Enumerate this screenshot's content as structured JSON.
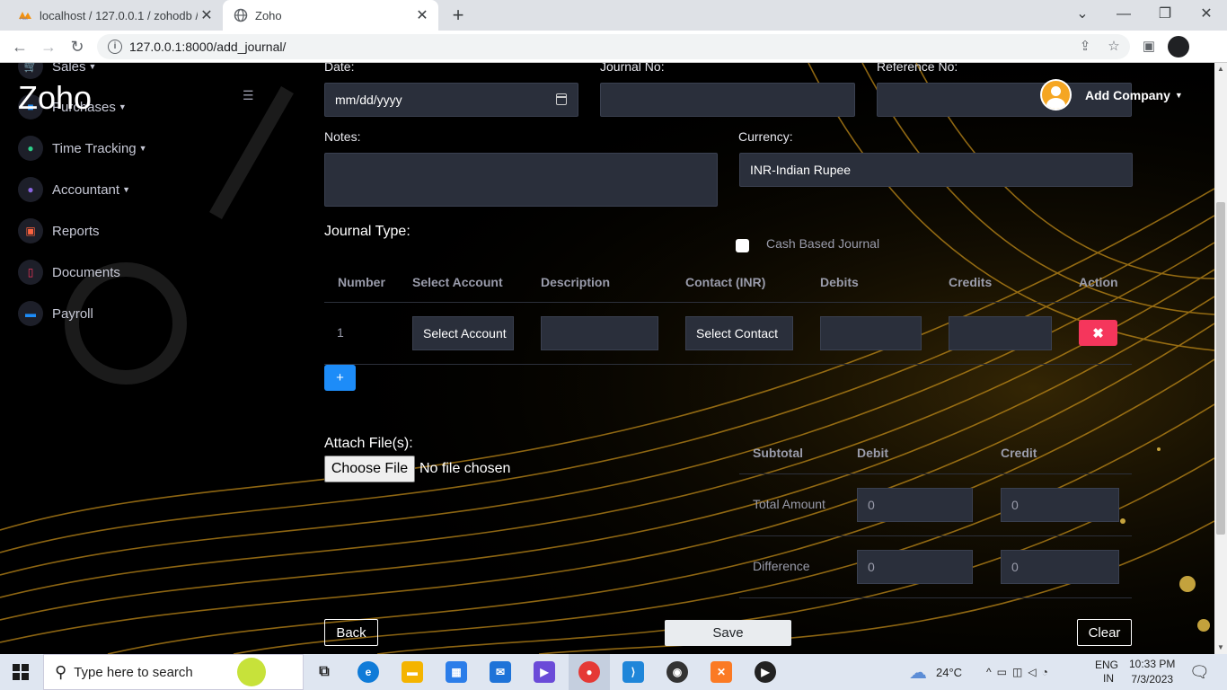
{
  "browser": {
    "tabs": [
      {
        "title": "localhost / 127.0.0.1 / zohodb / z",
        "favicon": "phpmyadmin-icon"
      },
      {
        "title": "Zoho",
        "favicon": "globe-icon",
        "active": true
      }
    ],
    "url": "127.0.0.1:8000/add_journal/"
  },
  "app": {
    "brand": "Zoho",
    "user": "Add Company",
    "sidebar": [
      {
        "label": "Sales",
        "icon": "cart-icon",
        "color": "#f5365c",
        "caret": true
      },
      {
        "label": "Purchases",
        "icon": "bag-icon",
        "color": "#1d8cf8",
        "caret": true
      },
      {
        "label": "Time Tracking",
        "icon": "clock-icon",
        "color": "#2dce89",
        "caret": true
      },
      {
        "label": "Accountant",
        "icon": "user-icon",
        "color": "#8965e0",
        "caret": true
      },
      {
        "label": "Reports",
        "icon": "calendar-icon",
        "color": "#fb6340",
        "caret": false
      },
      {
        "label": "Documents",
        "icon": "document-icon",
        "color": "#f5365c",
        "caret": false
      },
      {
        "label": "Payroll",
        "icon": "money-icon",
        "color": "#1d8cf8",
        "caret": false
      }
    ]
  },
  "form": {
    "date_label": "Date:",
    "date_value": "mm/dd/yyyy",
    "journal_no_label": "Journal No:",
    "reference_no_label": "Reference No:",
    "notes_label": "Notes:",
    "currency_label": "Currency:",
    "currency_value": "INR-Indian Rupee",
    "journal_type_label": "Journal Type:",
    "cash_based_label": "Cash Based Journal"
  },
  "table": {
    "headers": [
      "Number",
      "Select Account",
      "Description",
      "Contact (INR)",
      "Debits",
      "Credits",
      "Action"
    ],
    "rows": [
      {
        "number": "1",
        "account": "Select Account",
        "contact": "Select Contact",
        "action": "✖"
      }
    ],
    "add_label": "+"
  },
  "attach": {
    "label": "Attach File(s):",
    "button": "Choose File",
    "status": "No file chosen"
  },
  "summary": {
    "headers": [
      "Subtotal",
      "Debit",
      "Credit"
    ],
    "rows": [
      {
        "label": "Total Amount",
        "debit": "0",
        "credit": "0"
      },
      {
        "label": "Difference",
        "debit": "0",
        "credit": "0"
      }
    ]
  },
  "buttons": {
    "back": "Back",
    "save": "Save",
    "clear": "Clear"
  },
  "taskbar": {
    "search_placeholder": "Type here to search",
    "weather": "24°C",
    "lang1": "ENG",
    "lang2": "IN",
    "time": "10:33 PM",
    "date": "7/3/2023"
  }
}
